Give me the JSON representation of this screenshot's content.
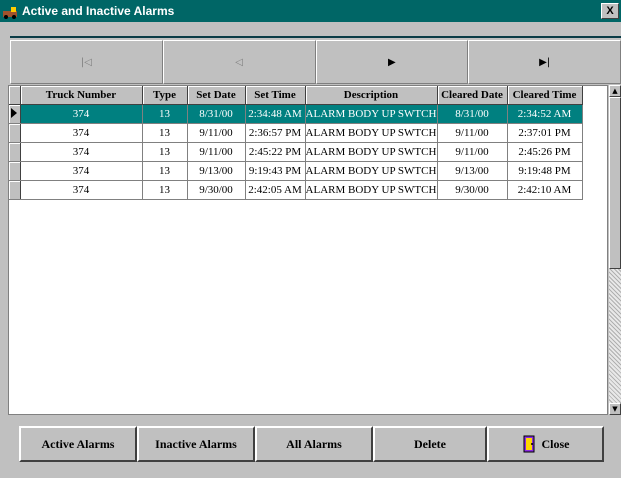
{
  "window": {
    "title": "Active and Inactive Alarms",
    "close_glyph": "X"
  },
  "nav": [
    {
      "glyph": "|◁",
      "disabled": true
    },
    {
      "glyph": "◁",
      "disabled": true
    },
    {
      "glyph": "▶",
      "disabled": false
    },
    {
      "glyph": "▶|",
      "disabled": false
    }
  ],
  "grid": {
    "columns": [
      "Truck Number",
      "Type",
      "Set Date",
      "Set Time",
      "Description",
      "Cleared Date",
      "Cleared Time"
    ],
    "rows": [
      [
        "374",
        "13",
        "8/31/00",
        "2:34:48 AM",
        "ALARM BODY UP SWTCH",
        "8/31/00",
        "2:34:52 AM"
      ],
      [
        "374",
        "13",
        "9/11/00",
        "2:36:57 PM",
        "ALARM BODY UP SWTCH",
        "9/11/00",
        "2:37:01 PM"
      ],
      [
        "374",
        "13",
        "9/11/00",
        "2:45:22 PM",
        "ALARM BODY UP SWTCH",
        "9/11/00",
        "2:45:26 PM"
      ],
      [
        "374",
        "13",
        "9/13/00",
        "9:19:43 PM",
        "ALARM BODY UP SWTCH",
        "9/13/00",
        "9:19:48 PM"
      ],
      [
        "374",
        "13",
        "9/30/00",
        "2:42:05 AM",
        "ALARM BODY UP SWTCH",
        "9/30/00",
        "2:42:10 AM"
      ]
    ],
    "selected_row": 0
  },
  "buttons": {
    "active": "Active Alarms",
    "inactive": "Inactive Alarms",
    "all": "All Alarms",
    "delete": "Delete",
    "close": "Close"
  },
  "colors": {
    "title_bg": "#006666",
    "selection": "#008080"
  }
}
